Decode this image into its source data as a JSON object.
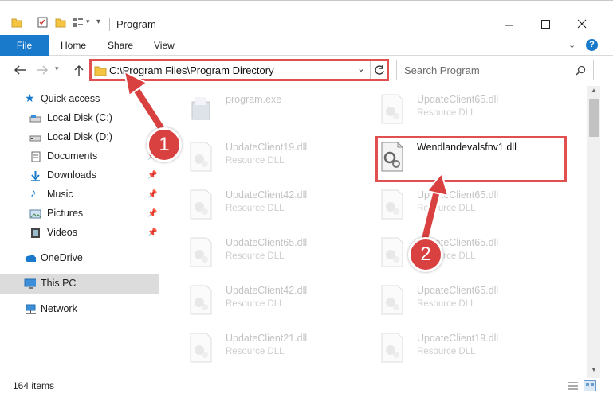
{
  "window": {
    "title": "Program"
  },
  "ribbon": {
    "file": "File",
    "tabs": [
      "Home",
      "Share",
      "View"
    ]
  },
  "address": {
    "path": "C:\\Program Files\\Program Directory"
  },
  "search": {
    "placeholder": "Search Program"
  },
  "sidebar": {
    "items": [
      {
        "label": "Quick access",
        "icon": "star-icon"
      },
      {
        "label": "Local Disk (C:)",
        "icon": "drive-icon"
      },
      {
        "label": "Local Disk (D:)",
        "icon": "drive-icon"
      },
      {
        "label": "Documents",
        "icon": "documents-icon"
      },
      {
        "label": "Downloads",
        "icon": "download-icon"
      },
      {
        "label": "Music",
        "icon": "music-icon"
      },
      {
        "label": "Pictures",
        "icon": "pictures-icon"
      },
      {
        "label": "Videos",
        "icon": "video-icon"
      },
      {
        "label": "OneDrive",
        "icon": "cloud-icon"
      },
      {
        "label": "This PC",
        "icon": "computer-icon"
      },
      {
        "label": "Network",
        "icon": "network-icon"
      }
    ]
  },
  "files": [
    {
      "name": "program.exe",
      "type": ""
    },
    {
      "name": "UpdateClient65.dll",
      "type": "Resource DLL"
    },
    {
      "name": "UpdateClient19.dll",
      "type": "Resource DLL"
    },
    {
      "name": "Wendlandevalsfnv1.dll",
      "type": ""
    },
    {
      "name": "UpdateClient42.dll",
      "type": "Resource DLL"
    },
    {
      "name": "UpdateClient65.dll",
      "type": "Resource DLL"
    },
    {
      "name": "UpdateClient65.dll",
      "type": "Resource DLL"
    },
    {
      "name": "UpdateClient65.dll",
      "type": "Resource DLL"
    },
    {
      "name": "UpdateClient42.dll",
      "type": "Resource DLL"
    },
    {
      "name": "UpdateClient65.dll",
      "type": "Resource DLL"
    },
    {
      "name": "UpdateClient21.dll",
      "type": "Resource DLL"
    },
    {
      "name": "UpdateClient19.dll",
      "type": "Resource DLL"
    }
  ],
  "status": {
    "count": "164 items"
  },
  "annotations": {
    "step1": "1",
    "step2": "2"
  },
  "colors": {
    "accent": "#1979ca",
    "annotation": "#d94040"
  }
}
